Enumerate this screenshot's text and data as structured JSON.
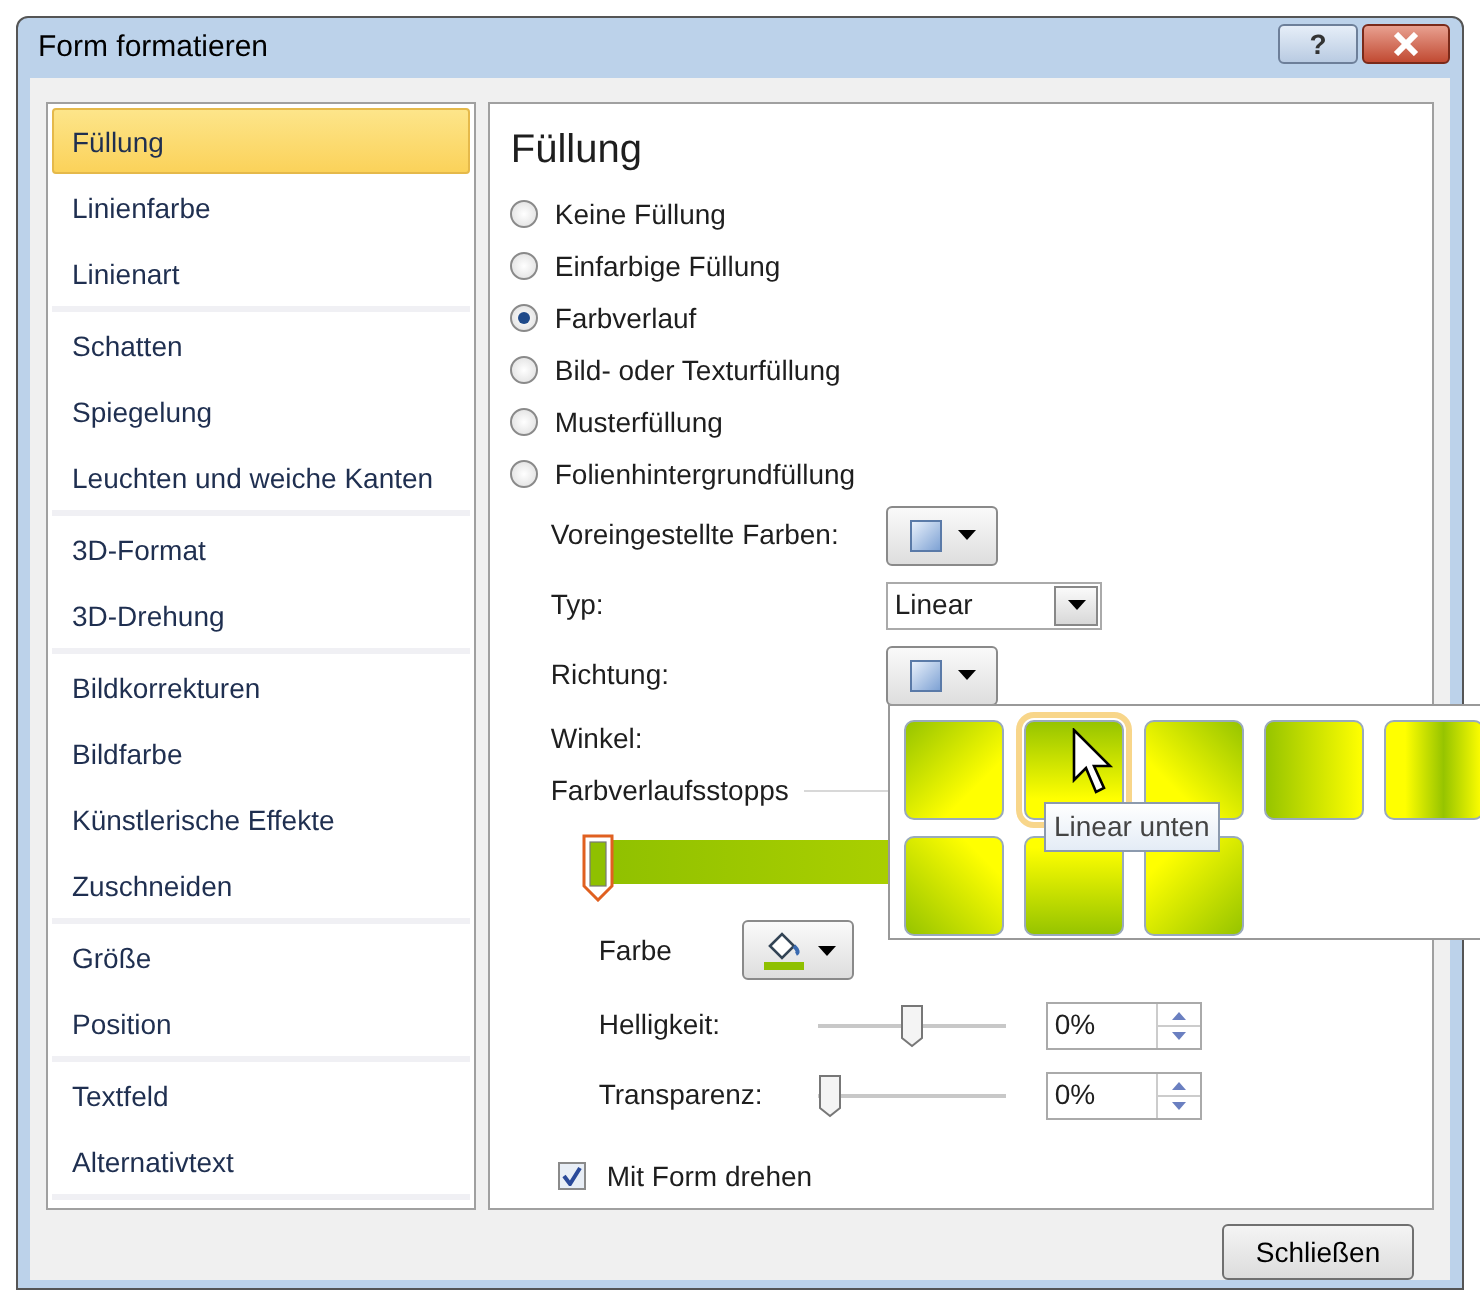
{
  "window": {
    "title": "Form formatieren",
    "help_label": "?"
  },
  "sidebar": {
    "groups": [
      [
        {
          "label": "Füllung",
          "selected": true
        },
        {
          "label": "Linienfarbe",
          "selected": false
        },
        {
          "label": "Linienart",
          "selected": false
        }
      ],
      [
        {
          "label": "Schatten",
          "selected": false
        },
        {
          "label": "Spiegelung",
          "selected": false
        },
        {
          "label": "Leuchten und weiche Kanten",
          "selected": false
        }
      ],
      [
        {
          "label": "3D-Format",
          "selected": false
        },
        {
          "label": "3D-Drehung",
          "selected": false
        }
      ],
      [
        {
          "label": "Bildkorrekturen",
          "selected": false
        },
        {
          "label": "Bildfarbe",
          "selected": false
        },
        {
          "label": "Künstlerische Effekte",
          "selected": false
        },
        {
          "label": "Zuschneiden",
          "selected": false
        }
      ],
      [
        {
          "label": "Größe",
          "selected": false
        },
        {
          "label": "Position",
          "selected": false
        }
      ],
      [
        {
          "label": "Textfeld",
          "selected": false
        },
        {
          "label": "Alternativtext",
          "selected": false
        }
      ]
    ]
  },
  "panel": {
    "heading": "Füllung",
    "fill_options": [
      {
        "label": "Keine Füllung",
        "selected": false
      },
      {
        "label": "Einfarbige Füllung",
        "selected": false
      },
      {
        "label": "Farbverlauf",
        "selected": true
      },
      {
        "label": "Bild- oder Texturfüllung",
        "selected": false
      },
      {
        "label": "Musterfüllung",
        "selected": false
      },
      {
        "label": "Folienhintergrundfüllung",
        "selected": false
      }
    ],
    "preset_colors": {
      "label": "Voreingestellte Farben:"
    },
    "type": {
      "label": "Typ:",
      "value": "Linear"
    },
    "direction": {
      "label": "Richtung:"
    },
    "angle": {
      "label": "Winkel:"
    },
    "gradient_stops": {
      "label": "Farbverlaufsstopps"
    },
    "color": {
      "label": "Farbe"
    },
    "brightness": {
      "label": "Helligkeit:",
      "level": 0.5,
      "value": "0%"
    },
    "transparency": {
      "label": "Transparenz:",
      "level": 0,
      "value": "0%"
    },
    "rotate_with_shape": {
      "label": "Mit Form drehen",
      "checked": true
    }
  },
  "direction_menu": {
    "tiles": [
      {
        "selected": false
      },
      {
        "selected": true
      },
      {
        "selected": false
      },
      {
        "selected": false
      },
      {
        "selected": false
      },
      {
        "selected": false
      },
      {
        "selected": false
      },
      {
        "selected": false
      }
    ],
    "tooltip": "Linear unten"
  },
  "close_button": "Schließen"
}
